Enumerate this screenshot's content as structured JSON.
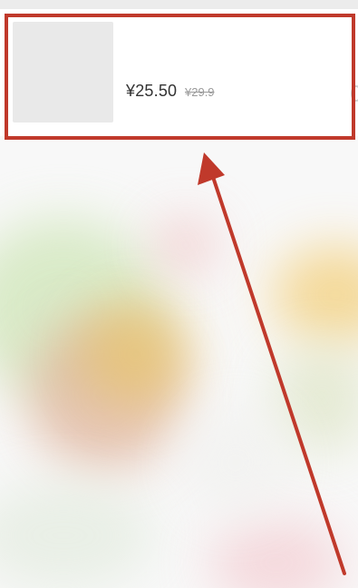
{
  "product": {
    "price": "¥25.50",
    "original_price": "¥29.9"
  },
  "annotation": {
    "color": "#c0392b"
  },
  "icons": {
    "thumbnail": "product-image-placeholder",
    "arrow": "arrow-up-icon"
  }
}
